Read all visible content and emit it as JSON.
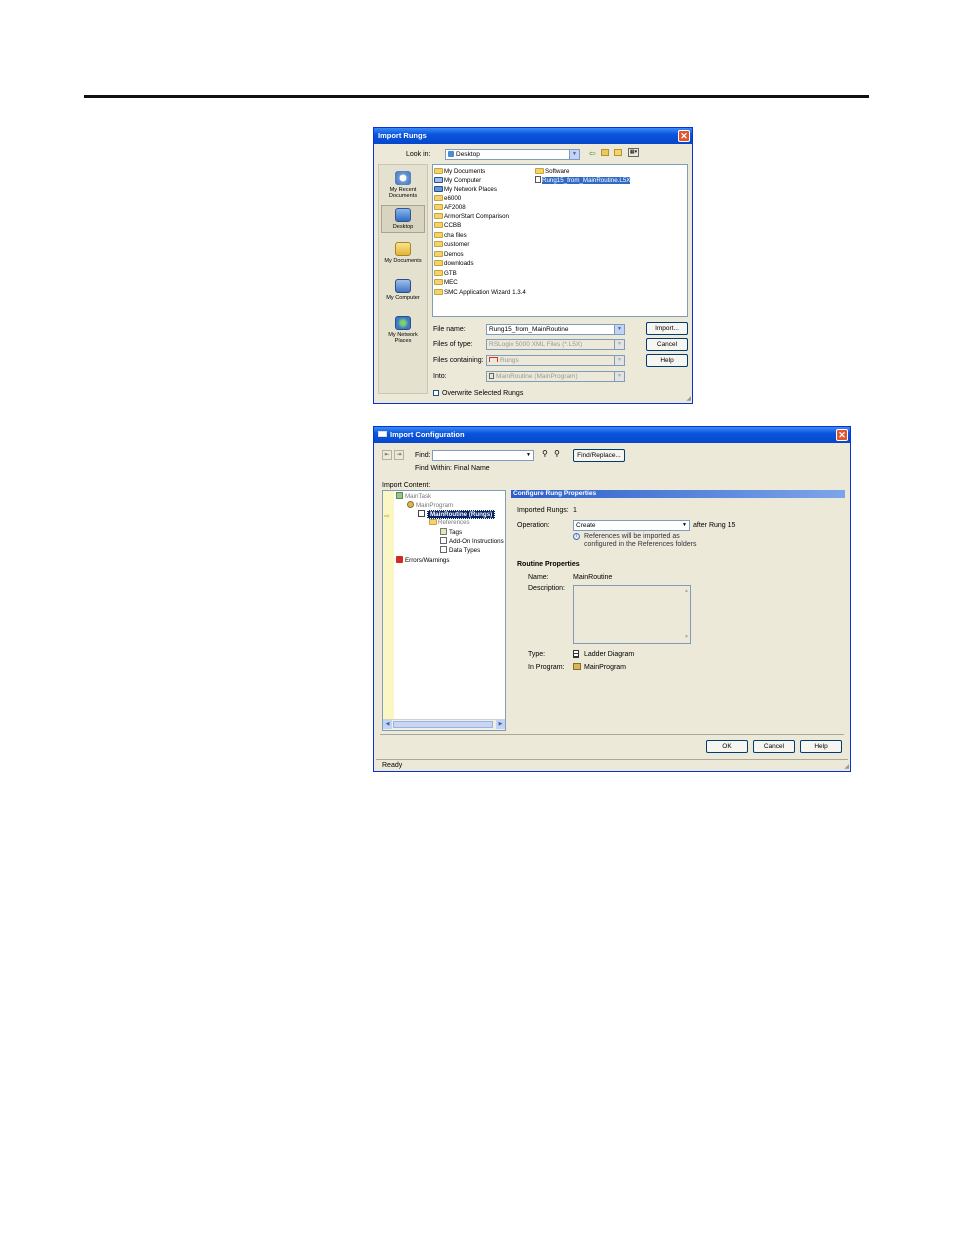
{
  "import_rungs": {
    "title": "Import Rungs",
    "look_in_label": "Look in:",
    "look_in_value": "Desktop",
    "places": [
      "My Recent Documents",
      "Desktop",
      "My Documents",
      "My Computer",
      "My Network Places"
    ],
    "files_col1": [
      "My Documents",
      "My Computer",
      "My Network Places",
      "e6000",
      "AF2008",
      "ArmorStart Comparison",
      "CCBB",
      "cha files",
      "customer",
      "Demos",
      "downloads",
      "GTB",
      "MEC",
      "SMC Application Wizard 1.3.4"
    ],
    "files_col2": [
      "Software",
      "Rung15_from_MainRoutine.L5X"
    ],
    "file_name_label": "File name:",
    "file_name_value": "Rung15_from_MainRoutine",
    "files_of_type_label": "Files of type:",
    "files_of_type_value": "RSLogix 5000 XML Files (*.L5X)",
    "files_containing_label": "Files containing:",
    "files_containing_value": "Rungs",
    "into_label": "Into:",
    "into_value": "MainRoutine (MainProgram)",
    "overwrite_label": "Overwrite Selected Rungs",
    "import_btn": "Import...",
    "cancel_btn": "Cancel",
    "help_btn": "Help"
  },
  "import_config": {
    "title": "Import Configuration",
    "find_label": "Find:",
    "find_replace_btn": "Find/Replace...",
    "find_within": "Find Within: Final Name",
    "import_content_label": "Import Content:",
    "tree": [
      "MainTask",
      "MainProgram",
      "MainRoutine (Rungs)",
      "References",
      "Tags",
      "Add-On Instructions",
      "Data Types",
      "Errors/Warnings"
    ],
    "section_header": "Configure Rung Properties",
    "imported_rungs_label": "Imported Rungs:",
    "imported_rungs_value": "1",
    "operation_label": "Operation:",
    "operation_value": "Create",
    "after_rung": "after Rung 15",
    "info_line1": "References will be imported as",
    "info_line2": "configured in the References folders",
    "routine_props": "Routine Properties",
    "name_label": "Name:",
    "name_value": "MainRoutine",
    "description_label": "Description:",
    "type_label": "Type:",
    "type_value": "Ladder Diagram",
    "in_program_label": "In Program:",
    "in_program_value": "MainProgram",
    "ok_btn": "OK",
    "cancel_btn": "Cancel",
    "help_btn": "Help",
    "status": "Ready"
  },
  "colors": {
    "titlebar": "#0a55de",
    "dialog_bg": "#ece9d8",
    "selection": "#316ac5"
  }
}
